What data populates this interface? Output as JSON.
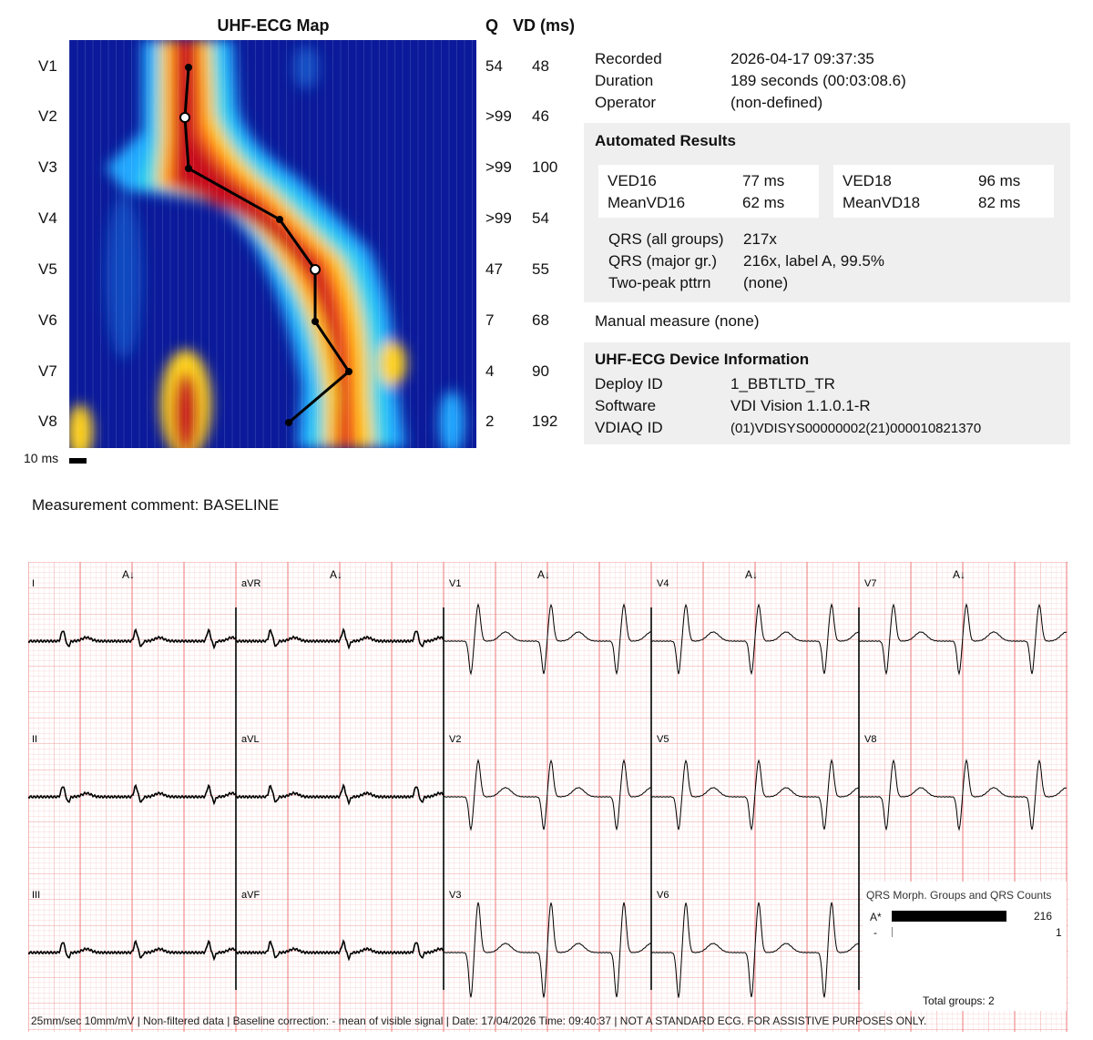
{
  "map": {
    "title": "UHF-ECG Map",
    "q_header": "Q",
    "vd_header": "VD (ms)",
    "scale_label": "10 ms",
    "leads": [
      {
        "name": "V1",
        "q": "54",
        "vd": "48"
      },
      {
        "name": "V2",
        "q": ">99",
        "vd": "46"
      },
      {
        "name": "V3",
        "q": ">99",
        "vd": "100"
      },
      {
        "name": "V4",
        "q": ">99",
        "vd": "54"
      },
      {
        "name": "V5",
        "q": "47",
        "vd": "55"
      },
      {
        "name": "V6",
        "q": "7",
        "vd": "68"
      },
      {
        "name": "V7",
        "q": "4",
        "vd": "90"
      },
      {
        "name": "V8",
        "q": "2",
        "vd": "192"
      }
    ]
  },
  "recording": {
    "recorded_label": "Recorded",
    "recorded_value": "2026-04-17 09:37:35",
    "duration_label": "Duration",
    "duration_value": "189 seconds (00:03:08.6)",
    "operator_label": "Operator",
    "operator_value": "(non-defined)"
  },
  "results": {
    "title": "Automated Results",
    "ved16_label": "VED16",
    "ved16_value": "77 ms",
    "meanvd16_label": "MeanVD16",
    "meanvd16_value": "62 ms",
    "ved18_label": "VED18",
    "ved18_value": "96 ms",
    "meanvd18_label": "MeanVD18",
    "meanvd18_value": "82 ms",
    "qrs_all_label": "QRS  (all groups)",
    "qrs_all_value": "217x",
    "qrs_major_label": "QRS  (major gr.)",
    "qrs_major_value": "216x, label A, 99.5%",
    "two_peak_label": "Two-peak  pttrn",
    "two_peak_value": "(none)"
  },
  "manual_measure": "Manual  measure  (none)",
  "device": {
    "title": "UHF-ECG Device Information",
    "deploy_label": "Deploy ID",
    "deploy_value": "1_BBTLTD_TR",
    "software_label": "Software",
    "software_value": "VDI Vision 1.1.0.1-R",
    "vdiaq_label": "VDIAQ  ID",
    "vdiaq_value": "(01)VDISYS00000002(21)000010821370"
  },
  "comment": "Measurement comment: BASELINE",
  "ecg": {
    "leads": [
      "I",
      "II",
      "III",
      "aVR",
      "aVL",
      "aVF",
      "V1",
      "V2",
      "V3",
      "V4",
      "V5",
      "V6",
      "V7",
      "V8"
    ],
    "beat_marker": "A↓",
    "footer": "25mm/sec   10mm/mV  | Non-filtered data | Baseline correction: - mean of visible signal  | Date: 17/04/2026 Time: 09:40:37  | NOT A STANDARD ECG. FOR ASSISTIVE PURPOSES ONLY."
  },
  "qrs_groups": {
    "title": "QRS Morph. Groups and QRS Counts",
    "total": "Total groups: 2",
    "groups": [
      {
        "label": "A*",
        "count": "216",
        "fraction": 0.995
      },
      {
        "label": "-",
        "count": "1",
        "fraction": 0.005
      }
    ]
  },
  "colors": {
    "ecg_grid_minor": "#f7c9c9",
    "ecg_grid_major": "#ee7d7d",
    "panel_bg": "#efefef"
  }
}
